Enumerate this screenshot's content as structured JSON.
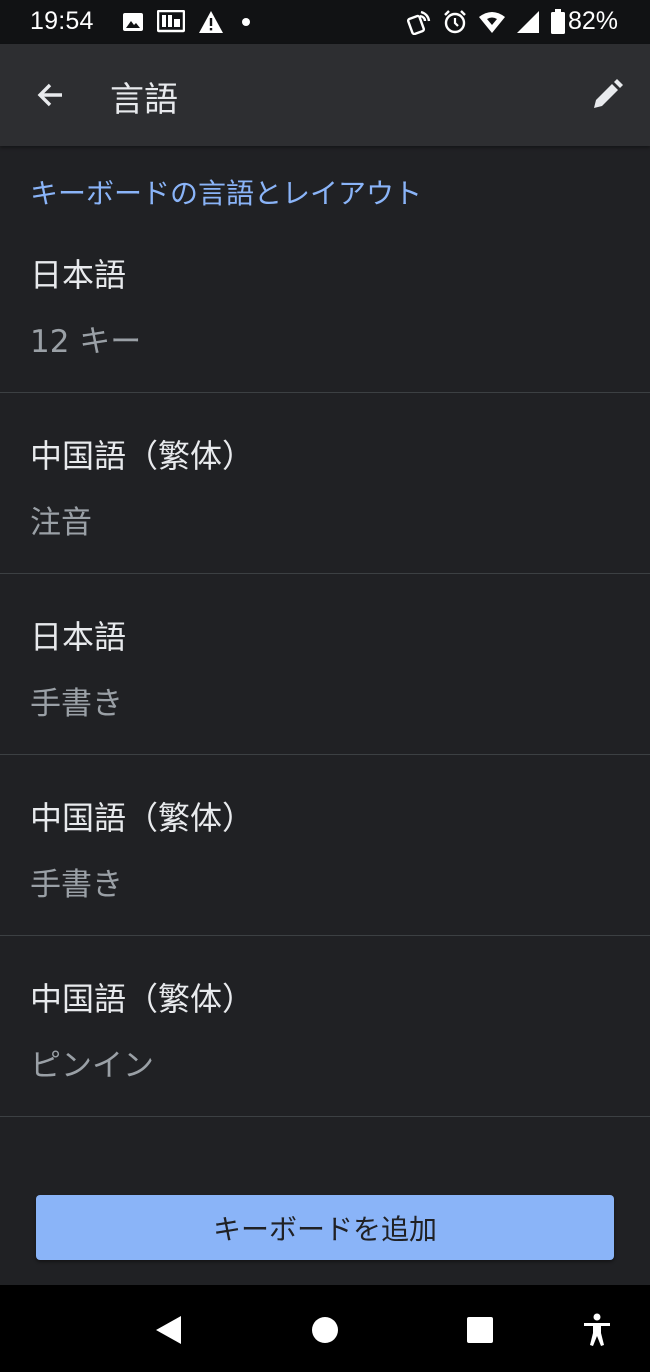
{
  "status_bar": {
    "time": "19:54",
    "left_icons": [
      "image-icon",
      "photo-gallery-icon",
      "warning-icon",
      "dot-icon"
    ],
    "right_icons": [
      "nfc-icon",
      "alarm-icon",
      "wifi-icon",
      "signal-icon",
      "battery-icon"
    ],
    "battery_percent": "82%"
  },
  "app_bar": {
    "title": "言語",
    "back_icon": "arrow-back-icon",
    "edit_icon": "pencil-icon"
  },
  "section": {
    "header": "キーボードの言語とレイアウト"
  },
  "keyboards": [
    {
      "language": "日本語",
      "layout": "12 キー"
    },
    {
      "language": "中国語（繁体）",
      "layout": "注音"
    },
    {
      "language": "日本語",
      "layout": "手書き"
    },
    {
      "language": "中国語（繁体）",
      "layout": "手書き"
    },
    {
      "language": "中国語（繁体）",
      "layout": "ピンイン"
    }
  ],
  "add_button_label": "キーボードを追加",
  "colors": {
    "background": "#202124",
    "app_bar": "#2d2e31",
    "accent": "#8ab4f8",
    "primary_text": "#e8eaed",
    "secondary_text": "#9aa0a6",
    "divider": "#3c4043"
  },
  "nav_bar": {
    "icons": [
      "back-triangle-icon",
      "home-circle-icon",
      "recents-square-icon",
      "accessibility-icon"
    ]
  }
}
